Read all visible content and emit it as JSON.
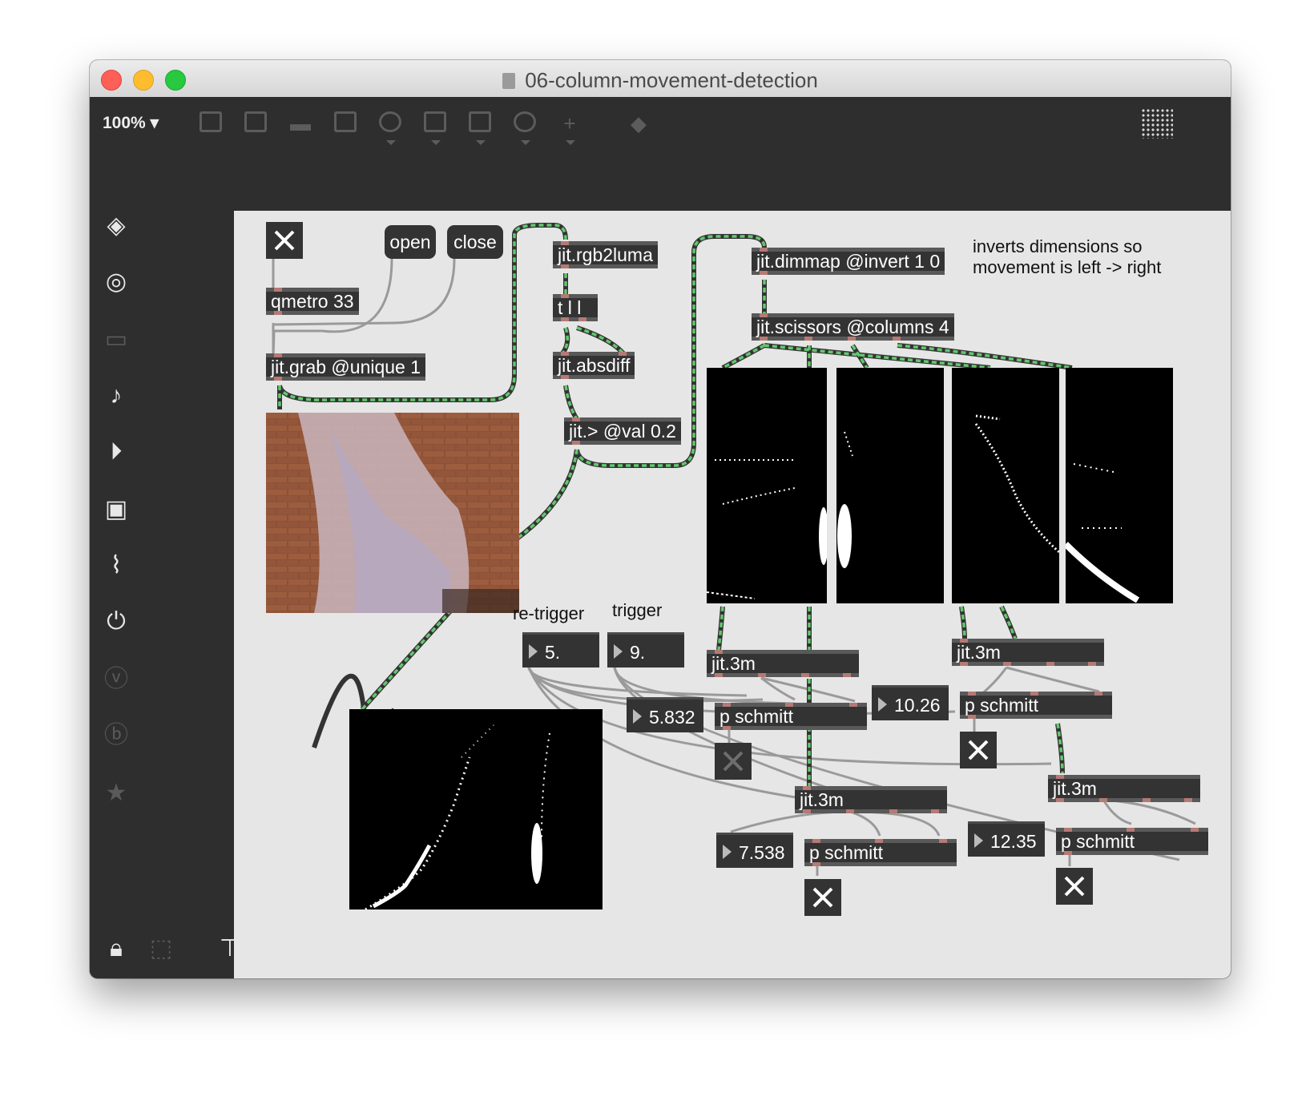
{
  "window": {
    "title": "06-column-movement-detection"
  },
  "toolbar": {
    "zoom": "100%"
  },
  "patch": {
    "objects": {
      "qmetro": "qmetro 33",
      "jit_grab": "jit.grab @unique 1",
      "rgb2luma": "jit.rgb2luma",
      "trigger": "t l l",
      "absdiff": "jit.absdiff",
      "threshold": "jit.> @val 0.2",
      "dimmap": "jit.dimmap @invert 1 0",
      "scissors": "jit.scissors @columns 4",
      "stats1": "jit.3m",
      "stats2": "jit.3m",
      "stats3": "jit.3m",
      "stats4": "jit.3m",
      "schmitt1": "p schmitt",
      "schmitt2": "p schmitt",
      "schmitt3": "p schmitt",
      "schmitt4": "p schmitt"
    },
    "buttons": {
      "open": "open",
      "close": "close"
    },
    "comments": {
      "inverts_line1": "inverts dimensions so",
      "inverts_line2": "movement is left -> right",
      "retrigger": "re-trigger",
      "trigger": "trigger"
    },
    "numbers": {
      "retrigger_value": "5.",
      "trigger_value": "9.",
      "mean1": "5.832",
      "mean2": "10.26",
      "mean3": "7.538",
      "mean4": "12.35"
    }
  },
  "icons": {
    "left_sidebar": [
      "cube-icon",
      "target-icon",
      "film-icon",
      "music-note-icon",
      "media-icon",
      "image-icon",
      "paperclip-icon",
      "plug-icon",
      "v-icon",
      "b-icon",
      "star-icon"
    ],
    "right_sidebar": [
      "search-icon",
      "info-icon",
      "columns-icon",
      "list-icon",
      "camera-icon",
      "mixer-icon"
    ],
    "bottom_bar": [
      "lock-icon",
      "select-icon",
      "presentation-icon",
      "windows-icon",
      "grid-icon",
      "paperclip-add-icon",
      "wrench-icon",
      "keyboard-icon",
      "computer-keyboard-icon",
      "audio-play-icon",
      "power-icon"
    ]
  },
  "colors": {
    "patch_bg": "#e6e6e6",
    "object_bg": "#333333",
    "matrix_cable": "#62c86d",
    "window_chrome": "#2e2e2e"
  }
}
